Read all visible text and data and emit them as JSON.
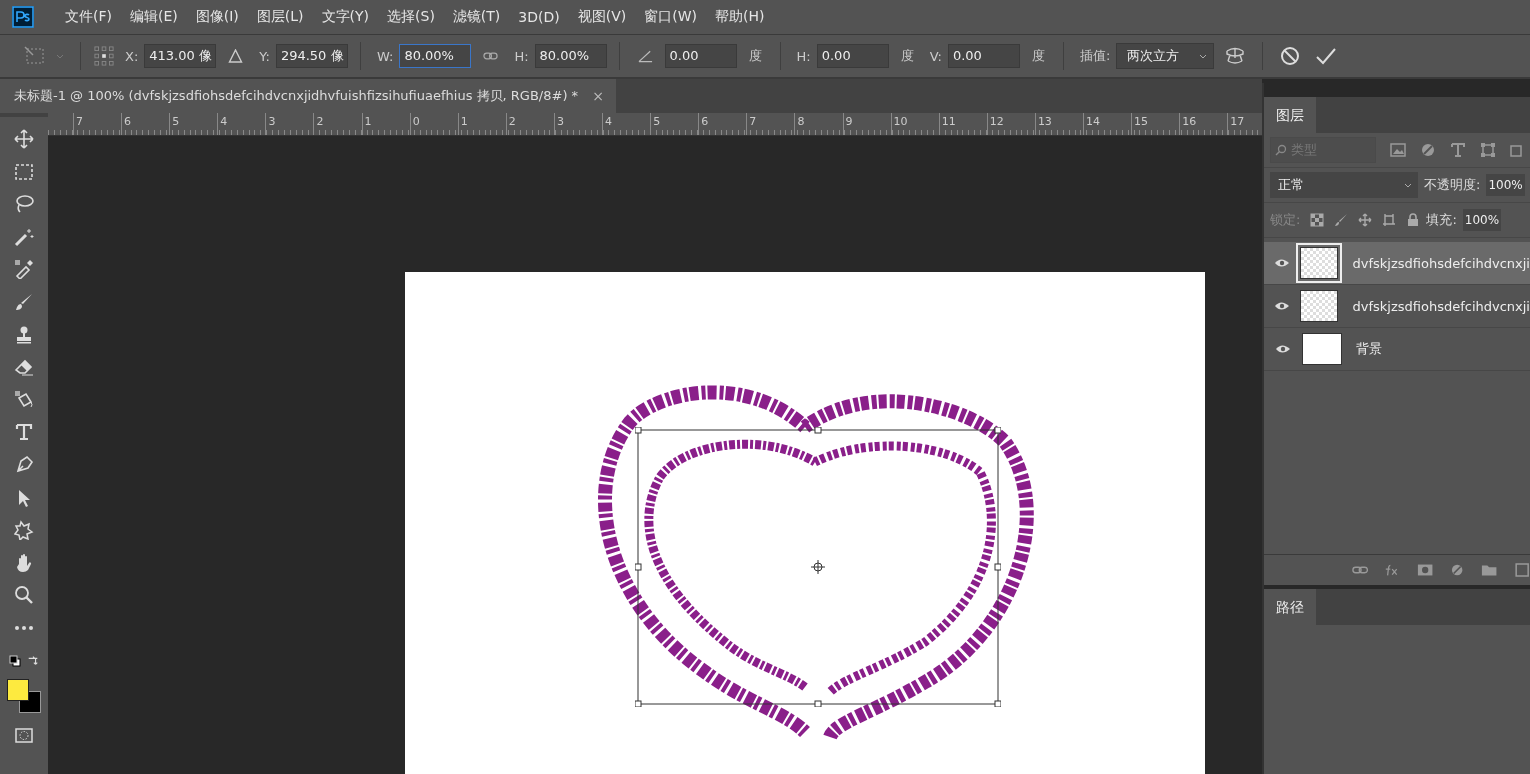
{
  "menu_bar": {
    "items": [
      "文件(F)",
      "编辑(E)",
      "图像(I)",
      "图层(L)",
      "文字(Y)",
      "选择(S)",
      "滤镜(T)",
      "3D(D)",
      "视图(V)",
      "窗口(W)",
      "帮助(H)"
    ]
  },
  "options_bar": {
    "fields": [
      {
        "kind": "text",
        "label": "X:",
        "value": "413.00 像",
        "focused": false
      },
      {
        "kind": "delta"
      },
      {
        "kind": "text",
        "label": "Y:",
        "value": "294.50 像",
        "focused": false
      },
      {
        "kind": "divider"
      },
      {
        "kind": "text",
        "label": "W:",
        "value": "80.00%",
        "focused": true
      },
      {
        "kind": "link"
      },
      {
        "kind": "text",
        "label": "H:",
        "value": "80.00%",
        "focused": false
      },
      {
        "kind": "divider"
      },
      {
        "kind": "angle",
        "value": "0.00",
        "unit": "度",
        "focused": false
      },
      {
        "kind": "divider"
      },
      {
        "kind": "text",
        "label": "H:",
        "value": "0.00",
        "unit": "度",
        "focused": false
      },
      {
        "kind": "text",
        "label": "V:",
        "value": "0.00",
        "unit": "度",
        "focused": false
      },
      {
        "kind": "divider"
      },
      {
        "kind": "select",
        "label": "插值:",
        "value": "两次立方"
      }
    ]
  },
  "document_tab": {
    "title": "未标题-1 @ 100% (dvfskjzsdfiohsdefcihdvcnxjidhvfuishfizsihufiuaefhius 拷贝, RGB/8#) *",
    "close": "×"
  },
  "ruler": {
    "labels": [
      "7",
      "6",
      "5",
      "4",
      "3",
      "2",
      "1",
      "0",
      "1",
      "2",
      "3",
      "4",
      "5",
      "6",
      "7",
      "8",
      "9",
      "10",
      "11",
      "12",
      "13",
      "14",
      "15",
      "16",
      "17"
    ]
  },
  "layers_panel": {
    "tab": "图层",
    "filter_placeholder": "类型",
    "blend_mode": "正常",
    "opacity_label": "不透明度:",
    "opacity": "100%",
    "lock_label": "锁定:",
    "fill_label": "填充:",
    "fill": "100%",
    "layers": [
      {
        "name": "dvfskjzsdfiohsdefcihdvcnxji",
        "kind": "transparent",
        "visible": true,
        "selected": true
      },
      {
        "name": "dvfskjzsdfiohsdefcihdvcnxji",
        "kind": "transparent",
        "visible": true,
        "selected": false
      },
      {
        "name": "背景",
        "kind": "white",
        "visible": true,
        "selected": false
      }
    ]
  },
  "paths_panel": {
    "tab": "路径"
  }
}
